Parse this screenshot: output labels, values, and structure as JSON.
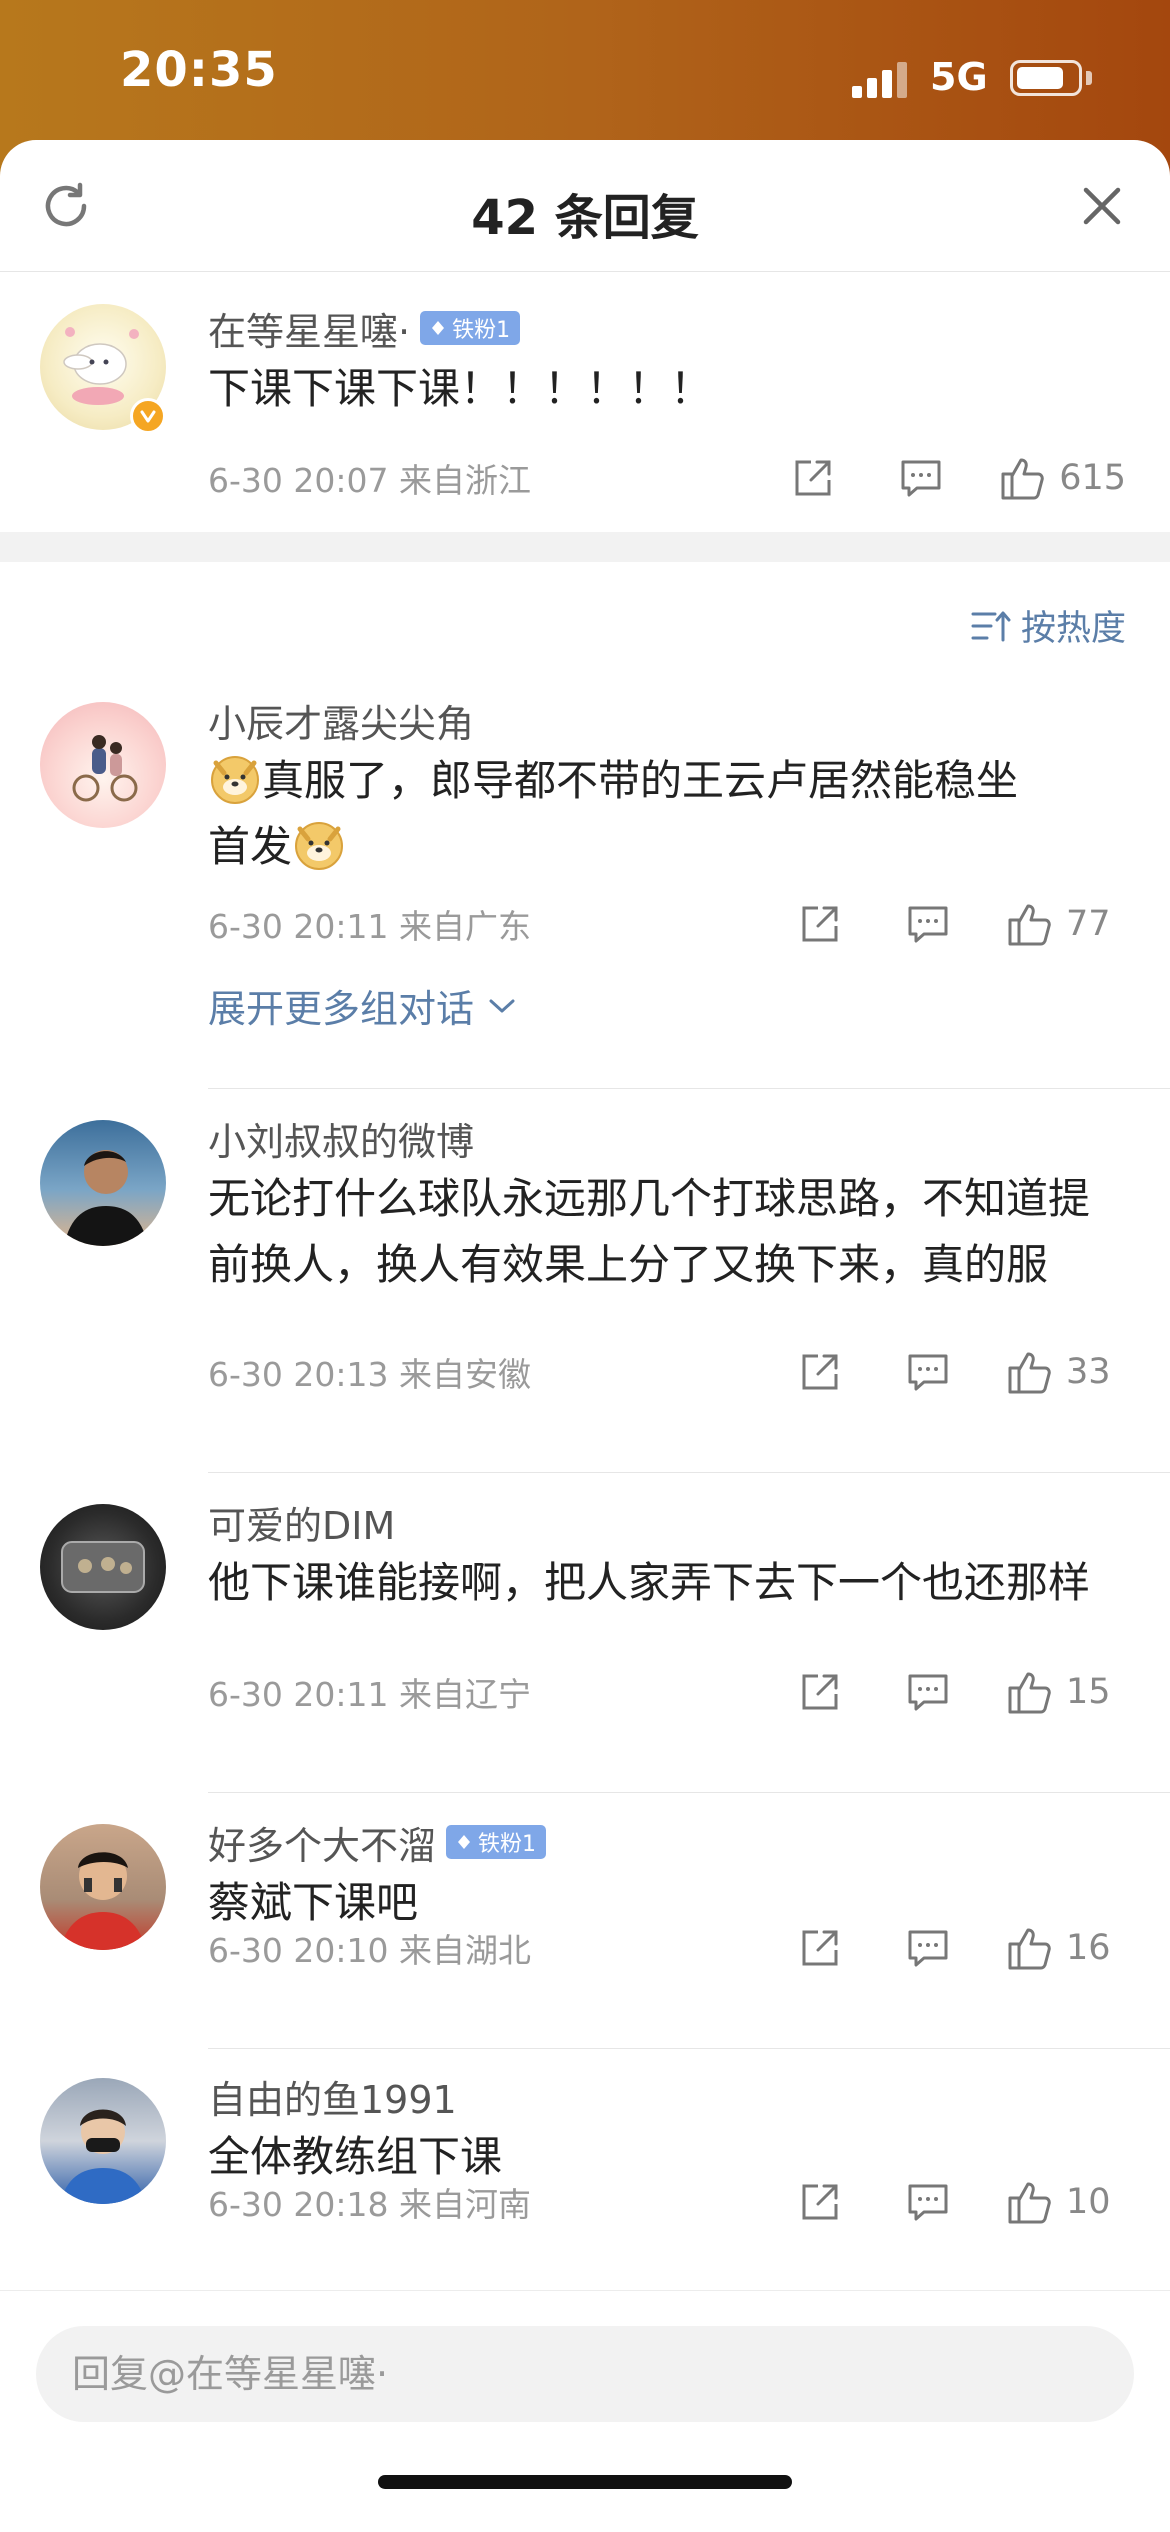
{
  "status_bar": {
    "time": "20:35",
    "network": "5G",
    "battery_level": 0.8
  },
  "header": {
    "title": "42 条回复"
  },
  "root_comment": {
    "name": "在等星星噻·",
    "badge": "铁粉1",
    "text": "下课下课下课！！！！！！",
    "meta": "6-30 20:07 来自浙江",
    "likes": "615"
  },
  "sort": {
    "label": "按热度"
  },
  "comments": [
    {
      "name": "小辰才露尖尖角",
      "text_a": "真服了，郎导都不带的王云卢居然能稳坐",
      "text_b": "首发",
      "meta": "6-30 20:11 来自广东",
      "likes": "77",
      "expand": "展开更多组对话"
    },
    {
      "name": "小刘叔叔的微博",
      "text": "无论打什么球队永远那几个打球思路，不知道提前换人，换人有效果上分了又换下来，真的服",
      "meta": "6-30 20:13 来自安徽",
      "likes": "33"
    },
    {
      "name": "可爱的DIM",
      "text": "他下课谁能接啊，把人家弄下去下一个也还那样",
      "meta": "6-30 20:11 来自辽宁",
      "likes": "15"
    },
    {
      "name": "好多个大不溜",
      "badge": "铁粉1",
      "text": "蔡斌下课吧",
      "meta": "6-30 20:10 来自湖北",
      "likes": "16"
    },
    {
      "name": "自由的鱼1991",
      "text": "全体教练组下课",
      "meta": "6-30 20:18 来自河南",
      "likes": "10"
    }
  ],
  "reply": {
    "placeholder": "回复@在等星星噻·"
  }
}
